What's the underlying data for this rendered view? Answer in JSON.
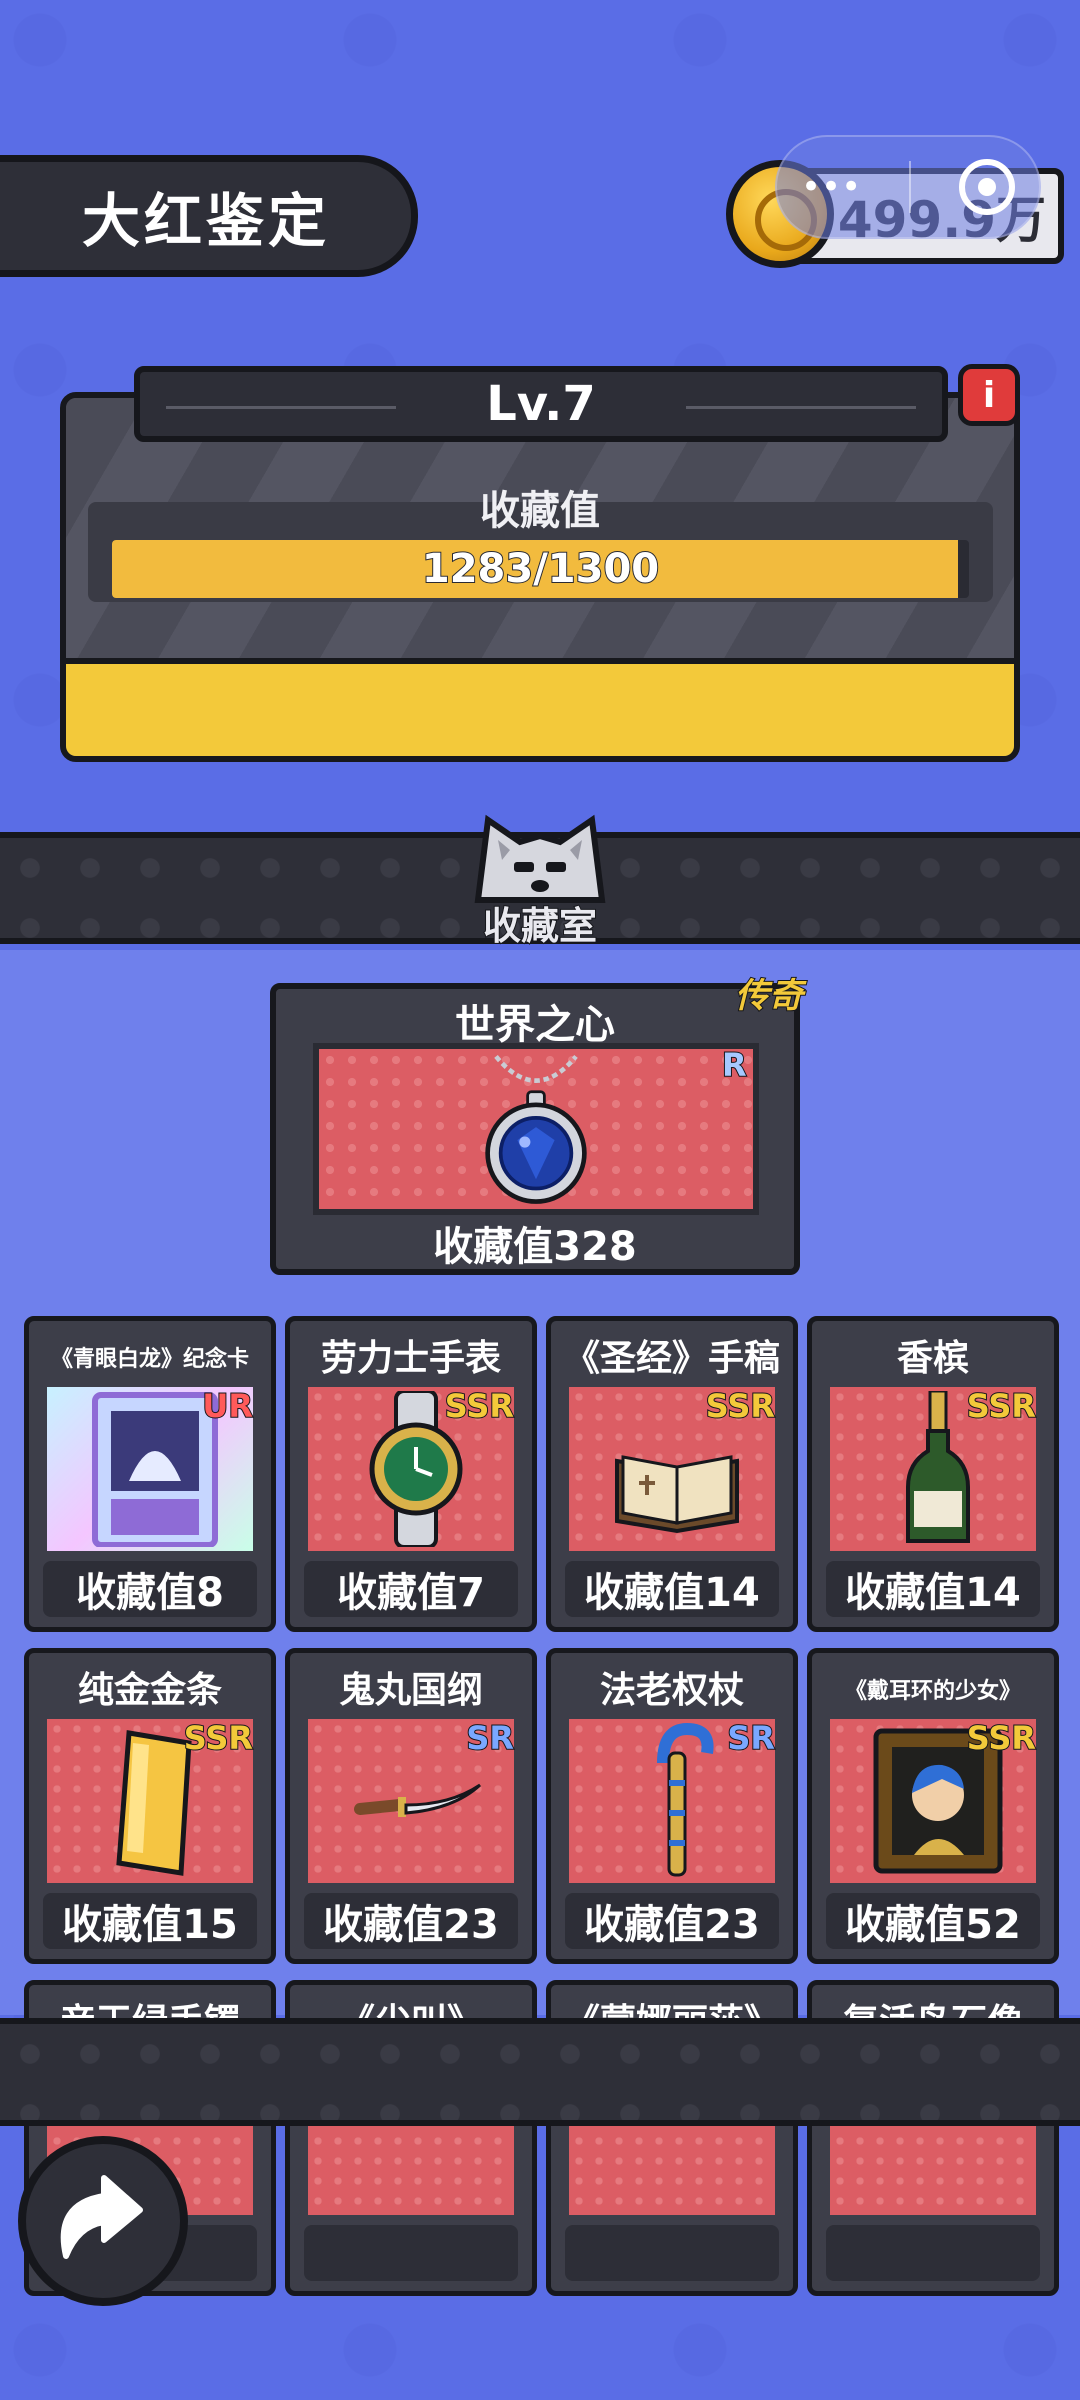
{
  "header": {
    "title": "大红鉴定",
    "coins": "499.9万",
    "capsule_dots": "•••"
  },
  "level": {
    "label": "Lv.7",
    "collection_label": "收藏值",
    "progress_text": "1283/1300",
    "progress_fraction": 0.987
  },
  "room": {
    "label": "收藏室"
  },
  "featured": {
    "name": "世界之心",
    "rarity": "传奇",
    "grade": "R",
    "value": "收藏值328"
  },
  "items": [
    {
      "name": "《青眼白龙》纪念卡",
      "grade": "UR",
      "value": "收藏值8",
      "icon": "card-icon"
    },
    {
      "name": "劳力士手表",
      "grade": "SSR",
      "value": "收藏值7",
      "icon": "watch-icon"
    },
    {
      "name": "《圣经》手稿",
      "grade": "SSR",
      "value": "收藏值14",
      "icon": "book-icon"
    },
    {
      "name": "香槟",
      "grade": "SSR",
      "value": "收藏值14",
      "icon": "bottle-icon"
    },
    {
      "name": "纯金金条",
      "grade": "SSR",
      "value": "收藏值15",
      "icon": "gold-bar-icon"
    },
    {
      "name": "鬼丸国纲",
      "grade": "SR",
      "value": "收藏值23",
      "icon": "sword-icon"
    },
    {
      "name": "法老权杖",
      "grade": "SR",
      "value": "收藏值23",
      "icon": "scepter-icon"
    },
    {
      "name": "《戴耳环的少女》",
      "grade": "SSR",
      "value": "收藏值52",
      "icon": "painting-icon"
    },
    {
      "name": "帝王绿手镯",
      "grade": "",
      "value": "",
      "icon": ""
    },
    {
      "name": "《尖叫》",
      "grade": "",
      "value": "",
      "icon": ""
    },
    {
      "name": "《蒙娜丽莎》",
      "grade": "",
      "value": "",
      "icon": ""
    },
    {
      "name": "复活岛石像",
      "grade": "",
      "value": "",
      "icon": ""
    }
  ],
  "colors": {
    "background": "#5a6de6",
    "panel": "#3d3e49",
    "accent_yellow": "#f3c93a",
    "item_bg": "#dc5d64",
    "grade_ur": "#ff5a5a",
    "grade_ssr": "#f3c93a",
    "grade_sr": "#7aa8ff"
  }
}
